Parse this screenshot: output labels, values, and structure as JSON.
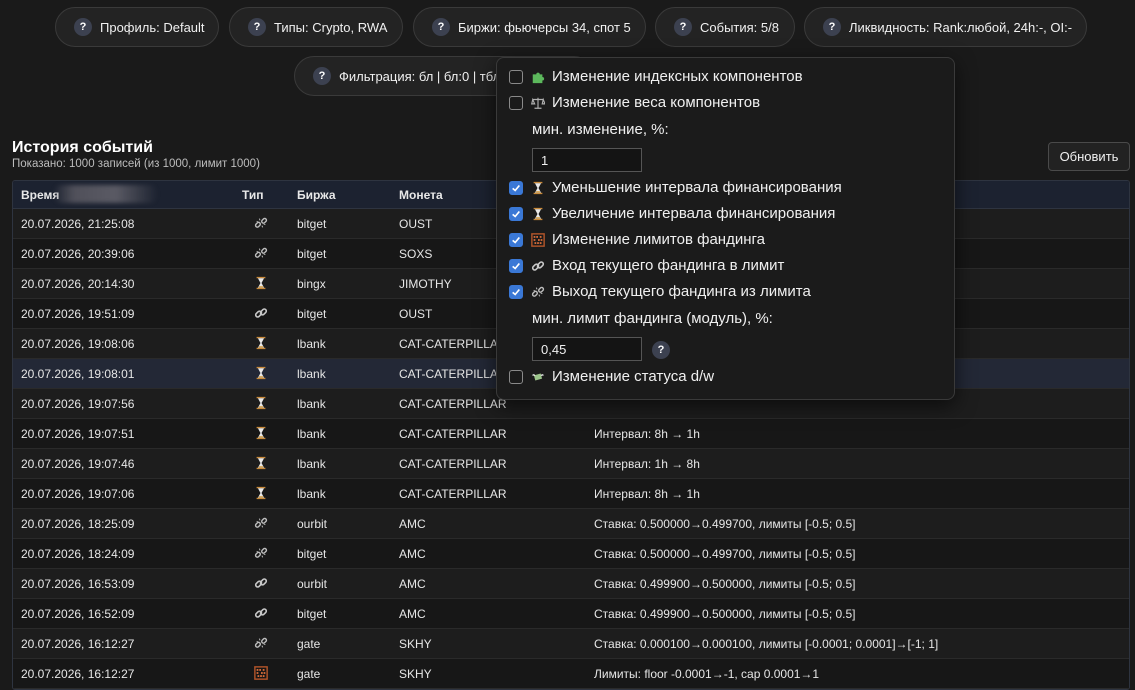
{
  "filters": {
    "profile": "Профиль: Default",
    "types": "Типы: Crypto, RWA",
    "exchanges": "Биржи: фьючерсы 34, спот 5",
    "events": "События: 5/8",
    "liquidity": "Ликвидность: Rank:любой, 24h:-, OI:-",
    "filtering": "Фильтрация: бл | бл:0 | тбл"
  },
  "help_glyph": "?",
  "history": {
    "title": "История событий",
    "subtitle": "Показано: 1000 записей (из 1000, лимит 1000)",
    "refresh_label": "Обновить"
  },
  "table": {
    "headers": {
      "time": "Время",
      "type": "Тип",
      "exchange": "Биржа",
      "coin": "Монета"
    },
    "rows": [
      {
        "time": "20.07.2026, 21:25:08",
        "icon": "broken-link-icon",
        "exchange": "bitget",
        "coin": "OUST",
        "desc": ""
      },
      {
        "time": "20.07.2026, 20:39:06",
        "icon": "broken-link-icon",
        "exchange": "bitget",
        "coin": "SOXS",
        "desc": ""
      },
      {
        "time": "20.07.2026, 20:14:30",
        "icon": "hourglass-icon",
        "exchange": "bingx",
        "coin": "JIMOTHY",
        "desc": ""
      },
      {
        "time": "20.07.2026, 19:51:09",
        "icon": "link-icon",
        "exchange": "bitget",
        "coin": "OUST",
        "desc": ""
      },
      {
        "time": "20.07.2026, 19:08:06",
        "icon": "hourglass-icon",
        "exchange": "lbank",
        "coin": "CAT-CATERPILLAR",
        "desc": ""
      },
      {
        "time": "20.07.2026, 19:08:01",
        "icon": "hourglass-icon",
        "exchange": "lbank",
        "coin": "CAT-CATERPILLAR",
        "desc": ""
      },
      {
        "time": "20.07.2026, 19:07:56",
        "icon": "hourglass-icon",
        "exchange": "lbank",
        "coin": "CAT-CATERPILLAR",
        "desc": ""
      },
      {
        "time": "20.07.2026, 19:07:51",
        "icon": "hourglass-icon",
        "exchange": "lbank",
        "coin": "CAT-CATERPILLAR",
        "desc": "Интервал: 8h → 1h"
      },
      {
        "time": "20.07.2026, 19:07:46",
        "icon": "hourglass-icon",
        "exchange": "lbank",
        "coin": "CAT-CATERPILLAR",
        "desc": "Интервал: 1h → 8h"
      },
      {
        "time": "20.07.2026, 19:07:06",
        "icon": "hourglass-icon",
        "exchange": "lbank",
        "coin": "CAT-CATERPILLAR",
        "desc": "Интервал: 8h → 1h"
      },
      {
        "time": "20.07.2026, 18:25:09",
        "icon": "broken-link-icon",
        "exchange": "ourbit",
        "coin": "AMC",
        "desc": "Ставка: 0.500000→0.499700, лимиты [-0.5; 0.5]"
      },
      {
        "time": "20.07.2026, 18:24:09",
        "icon": "broken-link-icon",
        "exchange": "bitget",
        "coin": "AMC",
        "desc": "Ставка: 0.500000→0.499700, лимиты [-0.5; 0.5]"
      },
      {
        "time": "20.07.2026, 16:53:09",
        "icon": "link-icon",
        "exchange": "ourbit",
        "coin": "AMC",
        "desc": "Ставка: 0.499900→0.500000, лимиты [-0.5; 0.5]"
      },
      {
        "time": "20.07.2026, 16:52:09",
        "icon": "link-icon",
        "exchange": "bitget",
        "coin": "AMC",
        "desc": "Ставка: 0.499900→0.500000, лимиты [-0.5; 0.5]"
      },
      {
        "time": "20.07.2026, 16:12:27",
        "icon": "broken-link-icon",
        "exchange": "gate",
        "coin": "SKHY",
        "desc": "Ставка: 0.000100→0.000100, лимиты [-0.0001; 0.0001]→[-1; 1]"
      },
      {
        "time": "20.07.2026, 16:12:27",
        "icon": "abacus-icon",
        "exchange": "gate",
        "coin": "SKHY",
        "desc": "Лимиты: floor -0.0001→-1, cap 0.0001→1"
      },
      {
        "time": "",
        "icon": "link-icon",
        "exchange": "",
        "coin": "",
        "desc": ""
      }
    ]
  },
  "events_menu": {
    "items": [
      {
        "label": "Изменение индексных компонентов",
        "checked": false,
        "icon": "puzzle-icon"
      },
      {
        "label": "Изменение веса компонентов",
        "checked": false,
        "icon": "scales-icon"
      },
      {
        "label": "Уменьшение интервала финансирования",
        "checked": true,
        "icon": "hourglass-icon"
      },
      {
        "label": "Увеличение интервала финансирования",
        "checked": true,
        "icon": "hourglass-icon"
      },
      {
        "label": "Изменение лимитов фандинга",
        "checked": true,
        "icon": "abacus-icon"
      },
      {
        "label": "Вход текущего фандинга в лимит",
        "checked": true,
        "icon": "link-icon"
      },
      {
        "label": "Выход текущего фандинга из лимита",
        "checked": true,
        "icon": "broken-link-icon"
      },
      {
        "label": "Изменение статуса d/w",
        "checked": false,
        "icon": "money-wings-icon"
      }
    ],
    "min_change_label": "мин. изменение, %:",
    "min_change_value": "1",
    "min_limit_label": "мин. лимит фандинга (модуль), %:",
    "min_limit_value": "0,45"
  },
  "colors": {
    "accent": "#3a78d6",
    "background": "#1a1a1a",
    "header": "#1c2230"
  }
}
